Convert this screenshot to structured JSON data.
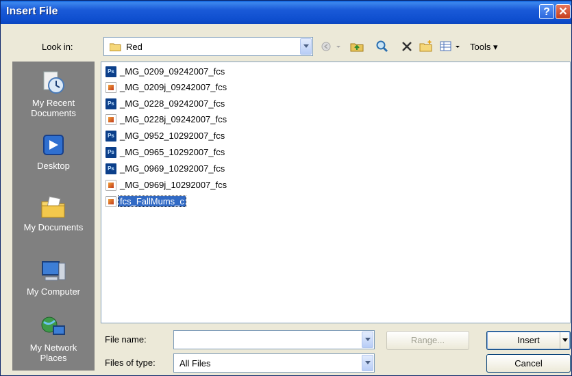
{
  "window": {
    "title": "Insert File"
  },
  "toolbar": {
    "look_in_label": "Look in:",
    "look_in_value": "Red",
    "tools_label": "Tools"
  },
  "places": [
    {
      "label_1": "My Recent",
      "label_2": "Documents",
      "icon": "recent-documents-icon"
    },
    {
      "label_1": "Desktop",
      "label_2": "",
      "icon": "desktop-icon"
    },
    {
      "label_1": "My Documents",
      "label_2": "",
      "icon": "my-documents-icon"
    },
    {
      "label_1": "My Computer",
      "label_2": "",
      "icon": "my-computer-icon"
    },
    {
      "label_1": "My Network",
      "label_2": "Places",
      "icon": "network-places-icon"
    }
  ],
  "files": [
    {
      "name": "_MG_0209_09242007_fcs",
      "type": "ps"
    },
    {
      "name": "_MG_0209j_09242007_fcs",
      "type": "img"
    },
    {
      "name": "_MG_0228_09242007_fcs",
      "type": "ps"
    },
    {
      "name": "_MG_0228j_09242007_fcs",
      "type": "img"
    },
    {
      "name": "_MG_0952_10292007_fcs",
      "type": "ps"
    },
    {
      "name": "_MG_0965_10292007_fcs",
      "type": "ps"
    },
    {
      "name": "_MG_0969_10292007_fcs",
      "type": "ps"
    },
    {
      "name": "_MG_0969j_10292007_fcs",
      "type": "img"
    },
    {
      "name": "fcs_FallMums_c",
      "type": "img",
      "selected": true
    }
  ],
  "bottom": {
    "filename_label": "File name:",
    "filename_value": "",
    "filetype_label": "Files of type:",
    "filetype_value": "All Files",
    "range_label": "Range...",
    "insert_label": "Insert",
    "cancel_label": "Cancel"
  },
  "colors": {
    "selection": "#316ac5",
    "titlebar": "#0f4fcf"
  }
}
